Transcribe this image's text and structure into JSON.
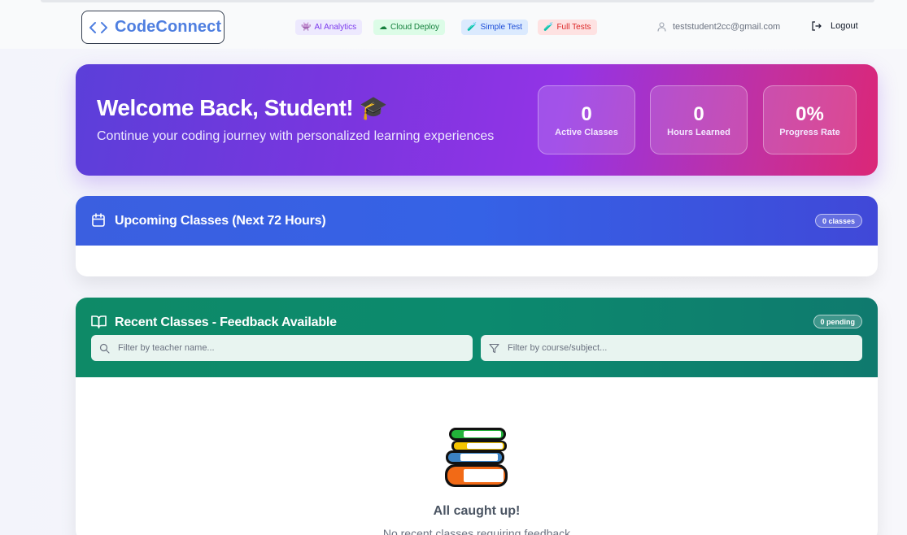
{
  "header": {
    "brand": "CodeConnect",
    "pills": {
      "ai_analytics": {
        "icon": "👾",
        "label": "AI Analytics"
      },
      "cloud_deploy": {
        "icon": "☁",
        "label": "Cloud Deploy"
      },
      "simple_test": {
        "icon": "🧪",
        "label": "Simple Test"
      },
      "full_tests": {
        "icon": "🧪",
        "label": "Full Tests"
      }
    },
    "user_email": "teststudent2cc@gmail.com",
    "logout_label": "Logout"
  },
  "hero": {
    "title": "Welcome Back, Student! 🎓",
    "subtitle": "Continue your coding journey with personalized learning experiences",
    "stats": [
      {
        "value": "0",
        "label": "Active Classes"
      },
      {
        "value": "0",
        "label": "Hours Learned"
      },
      {
        "value": "0%",
        "label": "Progress Rate"
      }
    ]
  },
  "upcoming": {
    "title": "Upcoming Classes (Next 72 Hours)",
    "badge": "0 classes"
  },
  "recent": {
    "title": "Recent Classes - Feedback Available",
    "badge": "0 pending",
    "teacher_filter_placeholder": "Filter by teacher name...",
    "course_filter_placeholder": "Filter by course/subject...",
    "empty_title": "All caught up!",
    "empty_subtitle": "No recent classes requiring feedback"
  },
  "colors": {
    "brand": "#4f7fe0",
    "hero_start": "#5b3fd9",
    "hero_end": "#db2777",
    "upcoming_bar": "#3562e6",
    "recent_bar": "#0e8a67"
  }
}
